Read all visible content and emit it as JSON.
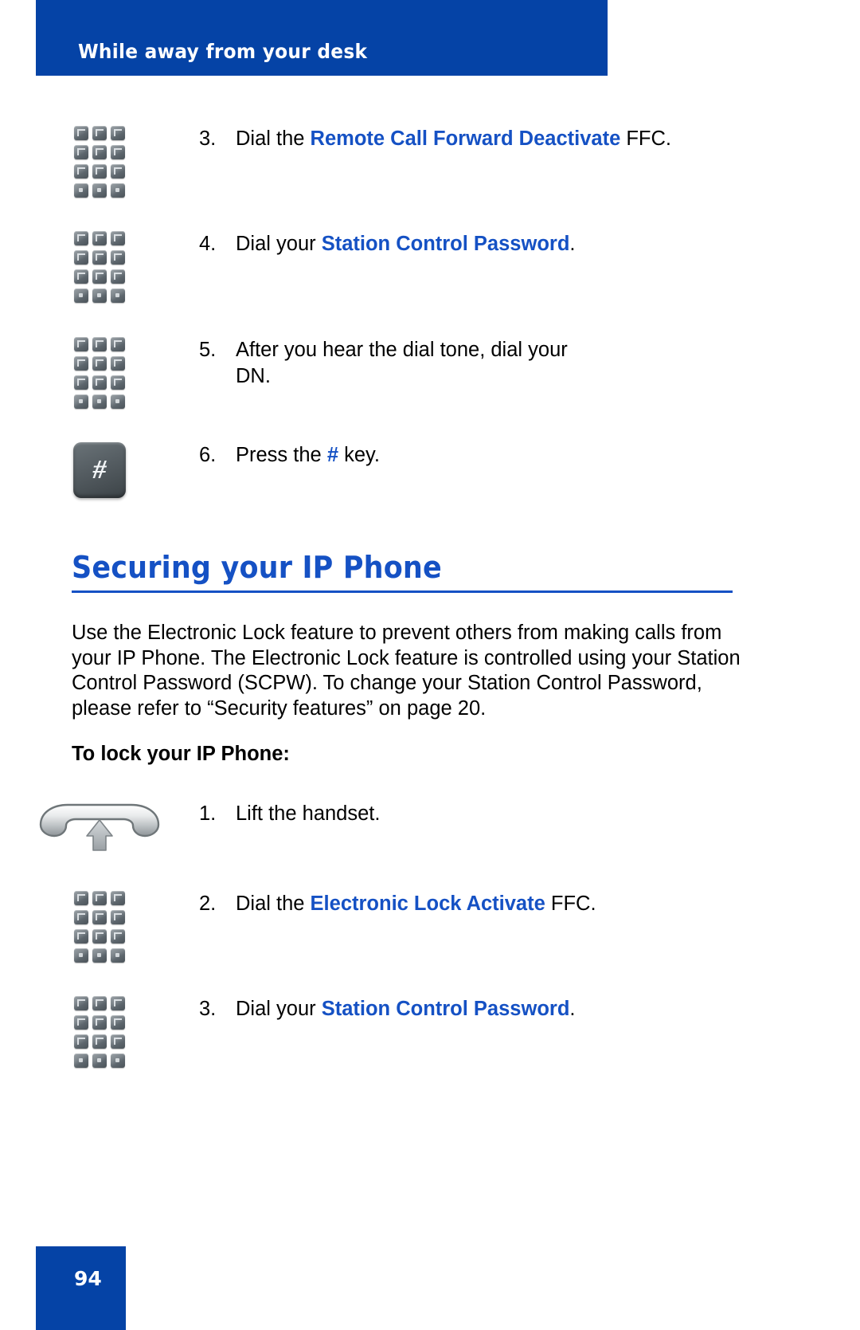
{
  "header": {
    "title": "While away from your desk"
  },
  "steps_top": [
    {
      "num": "3.",
      "icon": "keypad-icon",
      "segments": [
        {
          "text": "Dial the ",
          "style": "plain"
        },
        {
          "text": "Remote Call Forward Deactivate",
          "style": "blue-bold"
        },
        {
          "text": " FFC.",
          "style": "plain"
        }
      ],
      "plain_text": "Dial the Remote Call Forward Deactivate FFC."
    },
    {
      "num": "4.",
      "icon": "keypad-icon",
      "segments": [
        {
          "text": "Dial your ",
          "style": "plain"
        },
        {
          "text": "Station Control Password",
          "style": "blue-bold"
        },
        {
          "text": ".",
          "style": "plain"
        }
      ],
      "plain_text": "Dial your Station Control Password."
    },
    {
      "num": "5.",
      "icon": "keypad-icon",
      "segments": [
        {
          "text": "After you hear the dial tone, dial your DN.",
          "style": "plain"
        }
      ],
      "plain_text": "After you hear the dial tone, dial your DN."
    },
    {
      "num": "6.",
      "icon": "hash-key-icon",
      "segments": [
        {
          "text": "Press the ",
          "style": "plain"
        },
        {
          "text": "#",
          "style": "blue-bold"
        },
        {
          "text": " key.",
          "style": "plain"
        }
      ],
      "plain_text": "Press the # key."
    }
  ],
  "section": {
    "heading": "Securing your IP Phone",
    "paragraph": "Use the Electronic Lock feature to prevent others from making calls from your IP Phone. The Electronic Lock feature is controlled using your Station Control Password (SCPW). To change your Station Control Password, please refer to “Security features” on page 20.",
    "sub_label": "To lock your IP Phone:"
  },
  "steps_lock": [
    {
      "num": "1.",
      "icon": "handset-icon",
      "segments": [
        {
          "text": "Lift the handset.",
          "style": "plain"
        }
      ],
      "plain_text": "Lift the handset."
    },
    {
      "num": "2.",
      "icon": "keypad-icon",
      "segments": [
        {
          "text": "Dial the ",
          "style": "plain"
        },
        {
          "text": "Electronic Lock Activate",
          "style": "blue-bold"
        },
        {
          "text": " FFC.",
          "style": "plain"
        }
      ],
      "plain_text": "Dial the Electronic Lock Activate FFC."
    },
    {
      "num": "3.",
      "icon": "keypad-icon",
      "segments": [
        {
          "text": "Dial your ",
          "style": "plain"
        },
        {
          "text": "Station Control Password",
          "style": "blue-bold"
        },
        {
          "text": ".",
          "style": "plain"
        }
      ],
      "plain_text": "Dial your Station Control Password."
    }
  ],
  "hash_key_glyph": "#",
  "footer": {
    "page_number": "94"
  },
  "colors": {
    "brand_blue": "#0543a6",
    "accent_blue": "#1551c4",
    "text_black": "#000000",
    "key_gray": "#5d666d"
  }
}
